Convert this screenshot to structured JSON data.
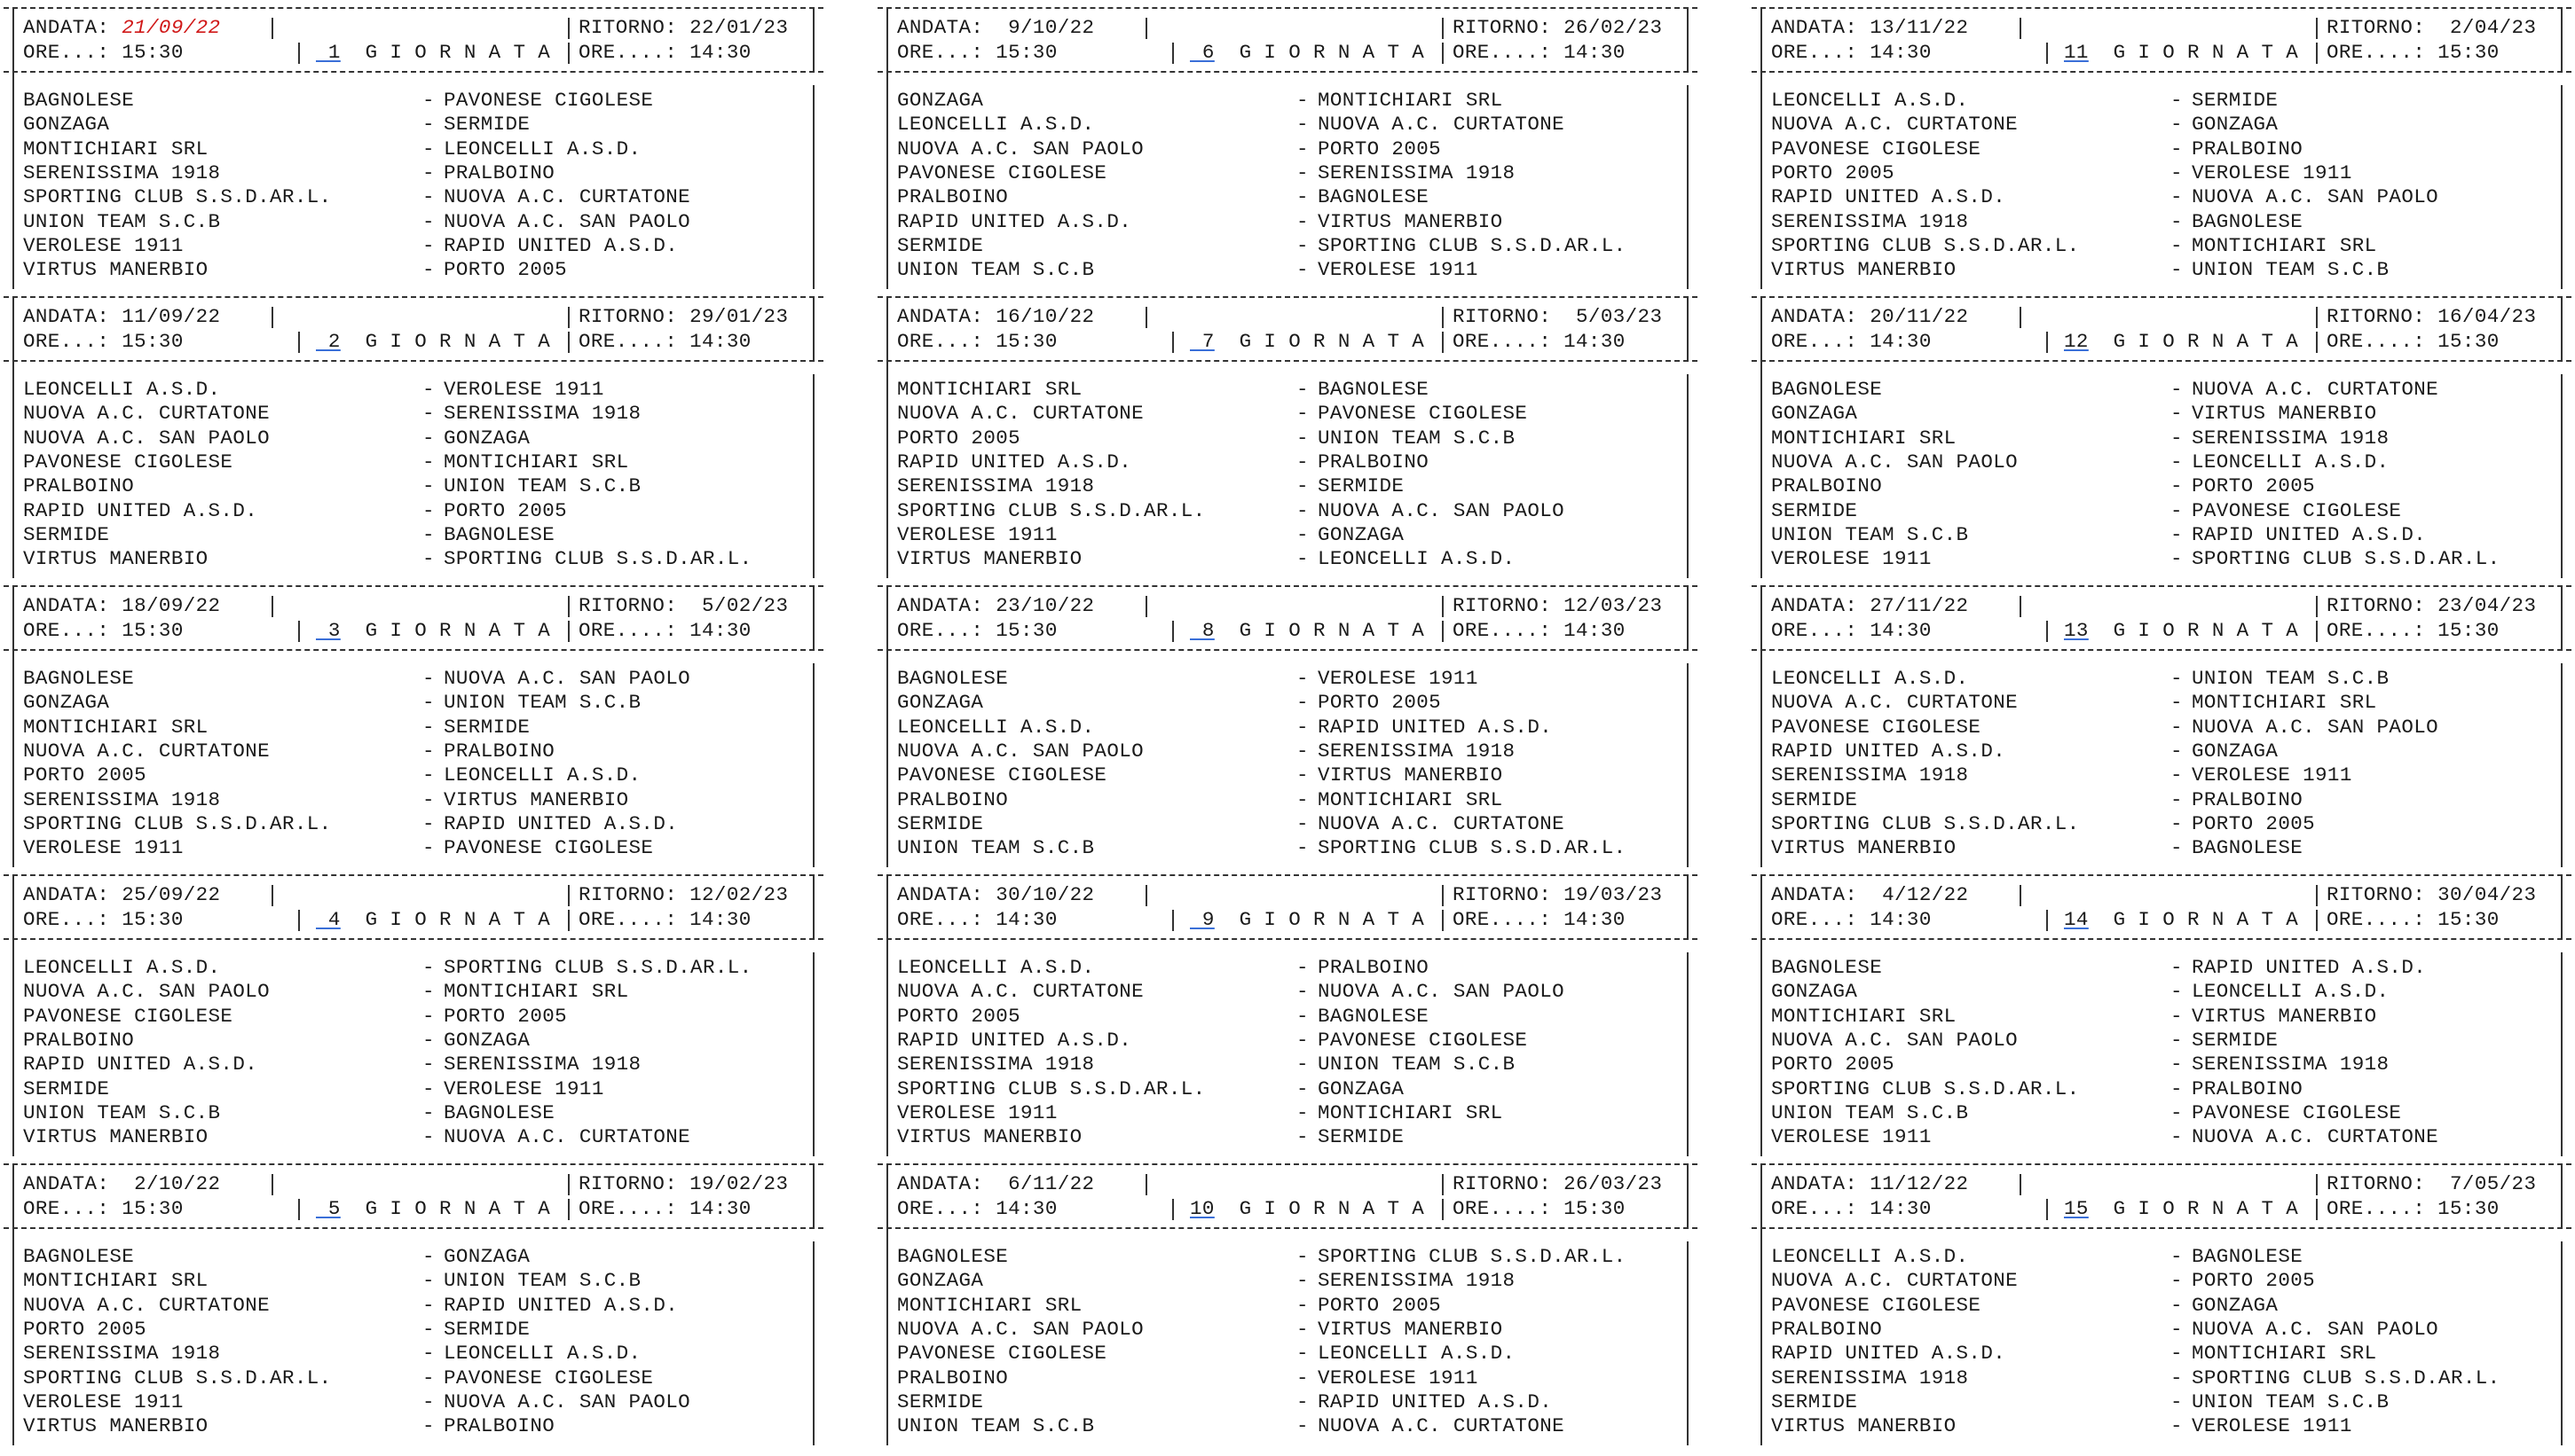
{
  "blocks": [
    {
      "andata": "21/09/22",
      "andata_red": true,
      "ritorno": "22/01/23",
      "ore_a": "15:30",
      "ore_r": "14:30",
      "giornata": "1",
      "matches": [
        [
          "BAGNOLESE",
          "PAVONESE CIGOLESE"
        ],
        [
          "GONZAGA",
          "SERMIDE"
        ],
        [
          "MONTICHIARI SRL",
          "LEONCELLI A.S.D."
        ],
        [
          "SERENISSIMA 1918",
          "PRALBOINO"
        ],
        [
          "SPORTING CLUB S.S.D.AR.L.",
          "NUOVA A.C. CURTATONE"
        ],
        [
          "UNION TEAM S.C.B",
          "NUOVA A.C. SAN PAOLO"
        ],
        [
          "VEROLESE 1911",
          "RAPID UNITED A.S.D."
        ],
        [
          "VIRTUS MANERBIO",
          "PORTO 2005"
        ]
      ]
    },
    {
      "andata": "11/09/22",
      "ritorno": "29/01/23",
      "ore_a": "15:30",
      "ore_r": "14:30",
      "giornata": "2",
      "matches": [
        [
          "LEONCELLI A.S.D.",
          "VEROLESE 1911"
        ],
        [
          "NUOVA A.C. CURTATONE",
          "SERENISSIMA 1918"
        ],
        [
          "NUOVA A.C. SAN PAOLO",
          "GONZAGA"
        ],
        [
          "PAVONESE CIGOLESE",
          "MONTICHIARI SRL"
        ],
        [
          "PRALBOINO",
          "UNION TEAM S.C.B"
        ],
        [
          "RAPID UNITED A.S.D.",
          "PORTO 2005"
        ],
        [
          "SERMIDE",
          "BAGNOLESE"
        ],
        [
          "VIRTUS MANERBIO",
          "SPORTING CLUB S.S.D.AR.L."
        ]
      ]
    },
    {
      "andata": "18/09/22",
      "ritorno": " 5/02/23",
      "ore_a": "15:30",
      "ore_r": "14:30",
      "giornata": "3",
      "matches": [
        [
          "BAGNOLESE",
          "NUOVA A.C. SAN PAOLO"
        ],
        [
          "GONZAGA",
          "UNION TEAM S.C.B"
        ],
        [
          "MONTICHIARI SRL",
          "SERMIDE"
        ],
        [
          "NUOVA A.C. CURTATONE",
          "PRALBOINO"
        ],
        [
          "PORTO 2005",
          "LEONCELLI A.S.D."
        ],
        [
          "SERENISSIMA 1918",
          "VIRTUS MANERBIO"
        ],
        [
          "SPORTING CLUB S.S.D.AR.L.",
          "RAPID UNITED A.S.D."
        ],
        [
          "VEROLESE 1911",
          "PAVONESE CIGOLESE"
        ]
      ]
    },
    {
      "andata": "25/09/22",
      "ritorno": "12/02/23",
      "ore_a": "15:30",
      "ore_r": "14:30",
      "giornata": "4",
      "matches": [
        [
          "LEONCELLI A.S.D.",
          "SPORTING CLUB S.S.D.AR.L."
        ],
        [
          "NUOVA A.C. SAN PAOLO",
          "MONTICHIARI SRL"
        ],
        [
          "PAVONESE CIGOLESE",
          "PORTO 2005"
        ],
        [
          "PRALBOINO",
          "GONZAGA"
        ],
        [
          "RAPID UNITED A.S.D.",
          "SERENISSIMA 1918"
        ],
        [
          "SERMIDE",
          "VEROLESE 1911"
        ],
        [
          "UNION TEAM S.C.B",
          "BAGNOLESE"
        ],
        [
          "VIRTUS MANERBIO",
          "NUOVA A.C. CURTATONE"
        ]
      ]
    },
    {
      "andata": " 2/10/22",
      "ritorno": "19/02/23",
      "ore_a": "15:30",
      "ore_r": "14:30",
      "giornata": "5",
      "matches": [
        [
          "BAGNOLESE",
          "GONZAGA"
        ],
        [
          "MONTICHIARI SRL",
          "UNION TEAM S.C.B"
        ],
        [
          "NUOVA A.C. CURTATONE",
          "RAPID UNITED A.S.D."
        ],
        [
          "PORTO 2005",
          "SERMIDE"
        ],
        [
          "SERENISSIMA 1918",
          "LEONCELLI A.S.D."
        ],
        [
          "SPORTING CLUB S.S.D.AR.L.",
          "PAVONESE CIGOLESE"
        ],
        [
          "VEROLESE 1911",
          "NUOVA A.C. SAN PAOLO"
        ],
        [
          "VIRTUS MANERBIO",
          "PRALBOINO"
        ]
      ]
    },
    {
      "andata": " 9/10/22",
      "ritorno": "26/02/23",
      "ore_a": "15:30",
      "ore_r": "14:30",
      "giornata": "6",
      "matches": [
        [
          "GONZAGA",
          "MONTICHIARI SRL"
        ],
        [
          "LEONCELLI A.S.D.",
          "NUOVA A.C. CURTATONE"
        ],
        [
          "NUOVA A.C. SAN PAOLO",
          "PORTO 2005"
        ],
        [
          "PAVONESE CIGOLESE",
          "SERENISSIMA 1918"
        ],
        [
          "PRALBOINO",
          "BAGNOLESE"
        ],
        [
          "RAPID UNITED A.S.D.",
          "VIRTUS MANERBIO"
        ],
        [
          "SERMIDE",
          "SPORTING CLUB S.S.D.AR.L."
        ],
        [
          "UNION TEAM S.C.B",
          "VEROLESE 1911"
        ]
      ]
    },
    {
      "andata": "16/10/22",
      "ritorno": " 5/03/23",
      "ore_a": "15:30",
      "ore_r": "14:30",
      "giornata": "7",
      "matches": [
        [
          "MONTICHIARI SRL",
          "BAGNOLESE"
        ],
        [
          "NUOVA A.C. CURTATONE",
          "PAVONESE CIGOLESE"
        ],
        [
          "PORTO 2005",
          "UNION TEAM S.C.B"
        ],
        [
          "RAPID UNITED A.S.D.",
          "PRALBOINO"
        ],
        [
          "SERENISSIMA 1918",
          "SERMIDE"
        ],
        [
          "SPORTING CLUB S.S.D.AR.L.",
          "NUOVA A.C. SAN PAOLO"
        ],
        [
          "VEROLESE 1911",
          "GONZAGA"
        ],
        [
          "VIRTUS MANERBIO",
          "LEONCELLI A.S.D."
        ]
      ]
    },
    {
      "andata": "23/10/22",
      "ritorno": "12/03/23",
      "ore_a": "15:30",
      "ore_r": "14:30",
      "giornata": "8",
      "matches": [
        [
          "BAGNOLESE",
          "VEROLESE 1911"
        ],
        [
          "GONZAGA",
          "PORTO 2005"
        ],
        [
          "LEONCELLI A.S.D.",
          "RAPID UNITED A.S.D."
        ],
        [
          "NUOVA A.C. SAN PAOLO",
          "SERENISSIMA 1918"
        ],
        [
          "PAVONESE CIGOLESE",
          "VIRTUS MANERBIO"
        ],
        [
          "PRALBOINO",
          "MONTICHIARI SRL"
        ],
        [
          "SERMIDE",
          "NUOVA A.C. CURTATONE"
        ],
        [
          "UNION TEAM S.C.B",
          "SPORTING CLUB S.S.D.AR.L."
        ]
      ]
    },
    {
      "andata": "30/10/22",
      "ritorno": "19/03/23",
      "ore_a": "14:30",
      "ore_r": "14:30",
      "giornata": "9",
      "matches": [
        [
          "LEONCELLI A.S.D.",
          "PRALBOINO"
        ],
        [
          "NUOVA A.C. CURTATONE",
          "NUOVA A.C. SAN PAOLO"
        ],
        [
          "PORTO 2005",
          "BAGNOLESE"
        ],
        [
          "RAPID UNITED A.S.D.",
          "PAVONESE CIGOLESE"
        ],
        [
          "SERENISSIMA 1918",
          "UNION TEAM S.C.B"
        ],
        [
          "SPORTING CLUB S.S.D.AR.L.",
          "GONZAGA"
        ],
        [
          "VEROLESE 1911",
          "MONTICHIARI SRL"
        ],
        [
          "VIRTUS MANERBIO",
          "SERMIDE"
        ]
      ]
    },
    {
      "andata": " 6/11/22",
      "ritorno": "26/03/23",
      "ore_a": "14:30",
      "ore_r": "15:30",
      "giornata": "10",
      "matches": [
        [
          "BAGNOLESE",
          "SPORTING CLUB S.S.D.AR.L."
        ],
        [
          "GONZAGA",
          "SERENISSIMA 1918"
        ],
        [
          "MONTICHIARI SRL",
          "PORTO 2005"
        ],
        [
          "NUOVA A.C. SAN PAOLO",
          "VIRTUS MANERBIO"
        ],
        [
          "PAVONESE CIGOLESE",
          "LEONCELLI A.S.D."
        ],
        [
          "PRALBOINO",
          "VEROLESE 1911"
        ],
        [
          "SERMIDE",
          "RAPID UNITED A.S.D."
        ],
        [
          "UNION TEAM S.C.B",
          "NUOVA A.C. CURTATONE"
        ]
      ]
    },
    {
      "andata": "13/11/22",
      "ritorno": " 2/04/23",
      "ore_a": "14:30",
      "ore_r": "15:30",
      "giornata": "11",
      "matches": [
        [
          "LEONCELLI A.S.D.",
          "SERMIDE"
        ],
        [
          "NUOVA A.C. CURTATONE",
          "GONZAGA"
        ],
        [
          "PAVONESE CIGOLESE",
          "PRALBOINO"
        ],
        [
          "PORTO 2005",
          "VEROLESE 1911"
        ],
        [
          "RAPID UNITED A.S.D.",
          "NUOVA A.C. SAN PAOLO"
        ],
        [
          "SERENISSIMA 1918",
          "BAGNOLESE"
        ],
        [
          "SPORTING CLUB S.S.D.AR.L.",
          "MONTICHIARI SRL"
        ],
        [
          "VIRTUS MANERBIO",
          "UNION TEAM S.C.B"
        ]
      ]
    },
    {
      "andata": "20/11/22",
      "ritorno": "16/04/23",
      "ore_a": "14:30",
      "ore_r": "15:30",
      "giornata": "12",
      "matches": [
        [
          "BAGNOLESE",
          "NUOVA A.C. CURTATONE"
        ],
        [
          "GONZAGA",
          "VIRTUS MANERBIO"
        ],
        [
          "MONTICHIARI SRL",
          "SERENISSIMA 1918"
        ],
        [
          "NUOVA A.C. SAN PAOLO",
          "LEONCELLI A.S.D."
        ],
        [
          "PRALBOINO",
          "PORTO 2005"
        ],
        [
          "SERMIDE",
          "PAVONESE CIGOLESE"
        ],
        [
          "UNION TEAM S.C.B",
          "RAPID UNITED A.S.D."
        ],
        [
          "VEROLESE 1911",
          "SPORTING CLUB S.S.D.AR.L."
        ]
      ]
    },
    {
      "andata": "27/11/22",
      "ritorno": "23/04/23",
      "ore_a": "14:30",
      "ore_r": "15:30",
      "giornata": "13",
      "matches": [
        [
          "LEONCELLI A.S.D.",
          "UNION TEAM S.C.B"
        ],
        [
          "NUOVA A.C. CURTATONE",
          "MONTICHIARI SRL"
        ],
        [
          "PAVONESE CIGOLESE",
          "NUOVA A.C. SAN PAOLO"
        ],
        [
          "RAPID UNITED A.S.D.",
          "GONZAGA"
        ],
        [
          "SERENISSIMA 1918",
          "VEROLESE 1911"
        ],
        [
          "SERMIDE",
          "PRALBOINO"
        ],
        [
          "SPORTING CLUB S.S.D.AR.L.",
          "PORTO 2005"
        ],
        [
          "VIRTUS MANERBIO",
          "BAGNOLESE"
        ]
      ]
    },
    {
      "andata": " 4/12/22",
      "ritorno": "30/04/23",
      "ore_a": "14:30",
      "ore_r": "15:30",
      "giornata": "14",
      "matches": [
        [
          "BAGNOLESE",
          "RAPID UNITED A.S.D."
        ],
        [
          "GONZAGA",
          "LEONCELLI A.S.D."
        ],
        [
          "MONTICHIARI SRL",
          "VIRTUS MANERBIO"
        ],
        [
          "NUOVA A.C. SAN PAOLO",
          "SERMIDE"
        ],
        [
          "PORTO 2005",
          "SERENISSIMA 1918"
        ],
        [
          "SPORTING CLUB S.S.D.AR.L.",
          "PRALBOINO"
        ],
        [
          "UNION TEAM S.C.B",
          "PAVONESE CIGOLESE"
        ],
        [
          "VEROLESE 1911",
          "NUOVA A.C. CURTATONE"
        ]
      ]
    },
    {
      "andata": "11/12/22",
      "ritorno": " 7/05/23",
      "ore_a": "14:30",
      "ore_r": "15:30",
      "giornata": "15",
      "matches": [
        [
          "LEONCELLI A.S.D.",
          "BAGNOLESE"
        ],
        [
          "NUOVA A.C. CURTATONE",
          "PORTO 2005"
        ],
        [
          "PAVONESE CIGOLESE",
          "GONZAGA"
        ],
        [
          "PRALBOINO",
          "NUOVA A.C. SAN PAOLO"
        ],
        [
          "RAPID UNITED A.S.D.",
          "MONTICHIARI SRL"
        ],
        [
          "SERENISSIMA 1918",
          "SPORTING CLUB S.S.D.AR.L."
        ],
        [
          "SERMIDE",
          "UNION TEAM S.C.B"
        ],
        [
          "VIRTUS MANERBIO",
          "VEROLESE 1911"
        ]
      ]
    }
  ],
  "labels": {
    "andata_prefix": "ANDATA: ",
    "ritorno_prefix": "RITORNO: ",
    "ore_a_prefix": "ORE...: ",
    "ore_r_prefix": "ORE....: ",
    "giornata_word": "G I O R N A T A",
    "dash": "-"
  },
  "colors": {
    "accent_red": "#d01818",
    "underline_blue": "#3a6fd8"
  }
}
